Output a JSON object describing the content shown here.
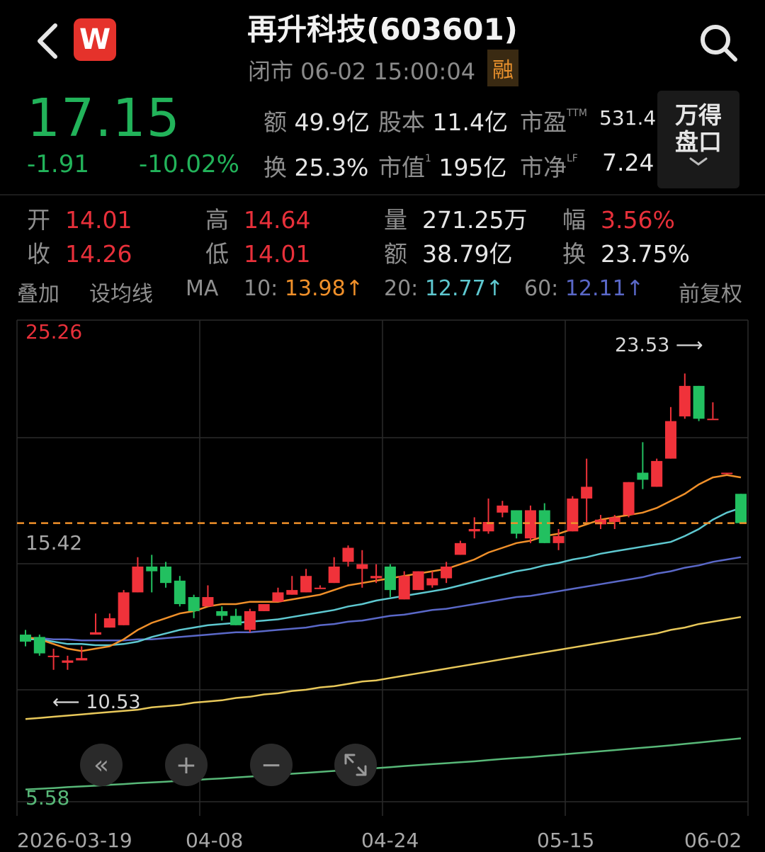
{
  "header": {
    "title": "再升科技(603601)",
    "status": "闭市 06-02 15:00:04",
    "badge": "融",
    "logo_text": "W",
    "back_icon": "chevron-left-icon",
    "search_icon": "search-icon"
  },
  "quote": {
    "price": "17.15",
    "change": "-1.91",
    "change_pct": "-10.02%",
    "price_color": "#22b35a"
  },
  "stats": {
    "amount_label": "额",
    "amount": "49.9亿",
    "shares_label": "股本",
    "shares": "11.4亿",
    "pe_label": "市盈",
    "pe_sup": "TTM",
    "pe": "531.4",
    "turnover_label": "换",
    "turnover": "25.3%",
    "mcap_label": "市值",
    "mcap_sup": "1",
    "mcap": "195亿",
    "pb_label": "市净",
    "pb_sup": "LF",
    "pb": "7.24"
  },
  "wande_button": {
    "line1": "万得",
    "line2": "盘口"
  },
  "ohlc": {
    "open_label": "开",
    "open": "14.01",
    "high_label": "高",
    "high": "14.64",
    "vol_label": "量",
    "vol": "271.25万",
    "amp_label": "幅",
    "amp": "3.56%",
    "close_label": "收",
    "close": "14.26",
    "low_label": "低",
    "low": "14.01",
    "amt_label": "额",
    "amt": "38.79亿",
    "to_label": "换",
    "to": "23.75%"
  },
  "ma_bar": {
    "overlay": "叠加",
    "set_ma": "设均线",
    "ma": "MA",
    "ma10_label": "10:",
    "ma10": "13.98↑",
    "ma20_label": "20:",
    "ma20": "12.77↑",
    "ma60_label": "60:",
    "ma60": "12.11↑",
    "adjust": "前复权",
    "colors": {
      "ma10": "#f0902a",
      "ma20": "#5ec8d0",
      "ma60": "#5a68c8",
      "ma120": "#e8c85a",
      "ma250": "#58b878"
    }
  },
  "chart_data": {
    "type": "candlestick",
    "y_top_label": "25.26",
    "y_mid_label": "15.42",
    "y_bottom_label": "5.58",
    "ylim": [
      5.58,
      25.26
    ],
    "max_label": "23.53 ⟶",
    "min_label": "⟵ 10.53",
    "last_close": 17.15,
    "x_ticks": [
      "2026-03-19",
      "04-08",
      "04-24",
      "05-15",
      "06-02"
    ],
    "candles": [
      [
        12.4,
        12.1,
        12.6,
        11.9
      ],
      [
        12.3,
        11.6,
        12.4,
        11.5
      ],
      [
        11.5,
        11.5,
        11.8,
        10.9
      ],
      [
        11.2,
        11.3,
        11.5,
        10.9
      ],
      [
        11.3,
        11.4,
        11.9,
        11.3
      ],
      [
        12.4,
        12.5,
        13.3,
        12.4
      ],
      [
        12.7,
        13.1,
        13.3,
        12.7
      ],
      [
        12.8,
        14.2,
        14.3,
        12.8
      ],
      [
        14.2,
        15.3,
        15.7,
        14.2
      ],
      [
        15.3,
        15.1,
        15.8,
        14.2
      ],
      [
        15.3,
        14.6,
        15.5,
        14.4
      ],
      [
        14.7,
        13.7,
        14.9,
        13.6
      ],
      [
        14.0,
        13.4,
        14.1,
        13.1
      ],
      [
        13.6,
        14.0,
        14.5,
        13.6
      ],
      [
        13.4,
        13.2,
        13.6,
        13.0
      ],
      [
        13.2,
        12.8,
        13.5,
        12.8
      ],
      [
        12.6,
        13.4,
        13.5,
        12.5
      ],
      [
        13.4,
        13.7,
        13.7,
        13.4
      ],
      [
        13.8,
        14.2,
        14.4,
        13.8
      ],
      [
        14.1,
        14.3,
        14.9,
        14.1
      ],
      [
        14.2,
        14.9,
        15.2,
        14.2
      ],
      [
        14.4,
        14.4,
        14.5,
        14.4
      ],
      [
        14.6,
        15.3,
        15.7,
        14.6
      ],
      [
        15.5,
        16.1,
        16.2,
        15.3
      ],
      [
        15.2,
        15.4,
        16.0,
        14.4
      ],
      [
        14.8,
        14.9,
        15.4,
        14.6
      ],
      [
        15.3,
        14.3,
        15.4,
        14.0
      ],
      [
        13.9,
        14.9,
        15.1,
        13.9
      ],
      [
        14.3,
        15.1,
        15.1,
        14.3
      ],
      [
        14.5,
        14.8,
        15.1,
        14.4
      ],
      [
        14.8,
        15.3,
        15.5,
        14.6
      ],
      [
        15.8,
        16.3,
        16.4,
        15.8
      ],
      [
        16.8,
        16.9,
        17.4,
        16.5
      ],
      [
        16.8,
        17.2,
        18.2,
        16.7
      ],
      [
        17.6,
        17.9,
        18.1,
        17.4
      ],
      [
        17.7,
        16.7,
        17.7,
        16.5
      ],
      [
        16.5,
        17.7,
        17.9,
        16.3
      ],
      [
        17.7,
        16.3,
        18.0,
        16.3
      ],
      [
        16.3,
        16.6,
        16.9,
        16.0
      ],
      [
        16.8,
        18.2,
        18.3,
        16.8
      ],
      [
        18.2,
        18.7,
        19.9,
        17.2
      ],
      [
        17.1,
        17.3,
        17.5,
        16.9
      ],
      [
        17.2,
        17.4,
        17.5,
        16.9
      ],
      [
        17.5,
        18.9,
        18.9,
        17.4
      ],
      [
        19.3,
        19.0,
        20.6,
        18.6
      ],
      [
        18.7,
        19.8,
        19.9,
        18.7
      ],
      [
        19.9,
        21.5,
        22.1,
        19.9
      ],
      [
        21.7,
        23.0,
        23.53,
        21.6
      ],
      [
        23.0,
        21.6,
        23.0,
        21.5
      ],
      [
        21.6,
        21.6,
        22.3,
        21.6
      ],
      [
        19.3,
        19.3,
        19.3,
        19.3
      ],
      [
        18.4,
        17.15,
        18.4,
        17.15
      ]
    ],
    "ma_series": {
      "ma10": [
        12.3,
        12.2,
        12.0,
        11.8,
        11.7,
        11.8,
        11.9,
        12.2,
        12.6,
        12.9,
        13.1,
        13.3,
        13.4,
        13.6,
        13.7,
        13.7,
        13.8,
        13.8,
        13.8,
        13.9,
        14.0,
        14.1,
        14.3,
        14.5,
        14.6,
        14.7,
        14.8,
        14.9,
        15.0,
        15.1,
        15.2,
        15.4,
        15.6,
        15.9,
        16.1,
        16.3,
        16.4,
        16.6,
        16.7,
        16.9,
        17.1,
        17.3,
        17.4,
        17.5,
        17.6,
        17.8,
        18.1,
        18.4,
        18.8,
        19.1,
        19.2,
        19.1
      ],
      "ma20": [
        12.2,
        12.2,
        12.1,
        12.0,
        12.0,
        11.95,
        11.95,
        12.0,
        12.1,
        12.3,
        12.45,
        12.6,
        12.7,
        12.8,
        12.85,
        12.9,
        12.95,
        13.0,
        13.05,
        13.15,
        13.25,
        13.35,
        13.45,
        13.6,
        13.7,
        13.85,
        13.95,
        14.05,
        14.15,
        14.25,
        14.35,
        14.5,
        14.65,
        14.8,
        14.95,
        15.1,
        15.2,
        15.35,
        15.45,
        15.6,
        15.7,
        15.85,
        15.95,
        16.05,
        16.15,
        16.25,
        16.35,
        16.6,
        16.9,
        17.3,
        17.6,
        17.8
      ],
      "ma60": [
        12.25,
        12.25,
        12.2,
        12.2,
        12.15,
        12.15,
        12.15,
        12.15,
        12.2,
        12.2,
        12.25,
        12.3,
        12.35,
        12.4,
        12.45,
        12.5,
        12.5,
        12.55,
        12.6,
        12.65,
        12.7,
        12.8,
        12.85,
        12.95,
        13.0,
        13.1,
        13.2,
        13.25,
        13.35,
        13.45,
        13.5,
        13.6,
        13.7,
        13.8,
        13.9,
        14.0,
        14.05,
        14.15,
        14.25,
        14.35,
        14.45,
        14.55,
        14.65,
        14.75,
        14.85,
        15.0,
        15.1,
        15.25,
        15.35,
        15.5,
        15.6,
        15.7
      ],
      "ma120": [
        8.8,
        8.85,
        8.9,
        8.95,
        9.0,
        9.05,
        9.1,
        9.15,
        9.2,
        9.3,
        9.35,
        9.4,
        9.5,
        9.55,
        9.6,
        9.7,
        9.75,
        9.85,
        9.9,
        10.0,
        10.05,
        10.15,
        10.2,
        10.3,
        10.4,
        10.45,
        10.55,
        10.65,
        10.75,
        10.85,
        10.95,
        11.05,
        11.15,
        11.25,
        11.35,
        11.45,
        11.55,
        11.65,
        11.75,
        11.85,
        11.95,
        12.05,
        12.15,
        12.25,
        12.35,
        12.45,
        12.6,
        12.7,
        12.85,
        12.95,
        13.05,
        13.15
      ],
      "ma250": [
        5.8,
        5.83,
        5.86,
        5.9,
        5.93,
        5.96,
        6.0,
        6.03,
        6.07,
        6.1,
        6.13,
        6.17,
        6.2,
        6.24,
        6.27,
        6.31,
        6.35,
        6.39,
        6.43,
        6.47,
        6.51,
        6.55,
        6.59,
        6.63,
        6.67,
        6.71,
        6.75,
        6.8,
        6.84,
        6.88,
        6.92,
        6.96,
        7.0,
        7.05,
        7.1,
        7.14,
        7.18,
        7.23,
        7.28,
        7.33,
        7.38,
        7.43,
        7.48,
        7.53,
        7.58,
        7.63,
        7.68,
        7.74,
        7.8,
        7.86,
        7.92,
        7.98
      ]
    }
  },
  "controls": {
    "back_btn": "«",
    "zoom_in": "+",
    "zoom_out": "−",
    "fullscreen": "expand-icon"
  }
}
